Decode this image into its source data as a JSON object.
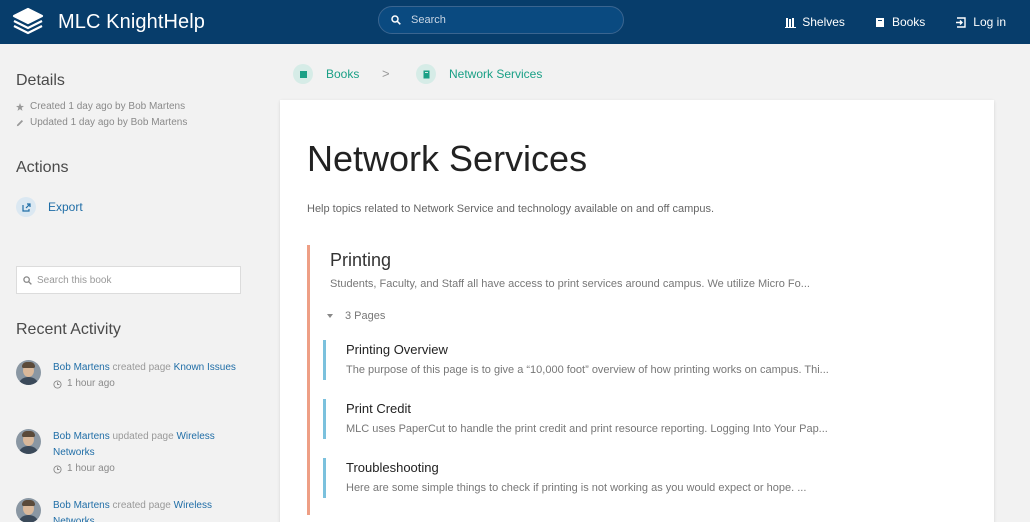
{
  "header": {
    "app_title": "MLC KnightHelp",
    "search_placeholder": "Search",
    "nav": [
      {
        "label": "Shelves",
        "icon": "shelves-icon"
      },
      {
        "label": "Books",
        "icon": "book-icon"
      },
      {
        "label": "Log in",
        "icon": "login-icon"
      }
    ],
    "bg_color": "#073d6b"
  },
  "sidebar": {
    "details_heading": "Details",
    "created": "Created 1 day ago by Bob Martens",
    "updated": "Updated 1 day ago by Bob Martens",
    "actions_heading": "Actions",
    "export_label": "Export",
    "book_search_placeholder": "Search this book",
    "recent_heading": "Recent Activity",
    "activity": [
      {
        "user": "Bob Martens",
        "verb": "created page",
        "target": "Known Issues",
        "time": "1 hour ago"
      },
      {
        "user": "Bob Martens",
        "verb": "updated page",
        "target": "Wireless Networks",
        "time": "1 hour ago"
      },
      {
        "user": "Bob Martens",
        "verb": "created page",
        "target": "Wireless Networks",
        "time": ""
      }
    ]
  },
  "breadcrumb": [
    {
      "label": "Books"
    },
    {
      "label": "Network Services"
    }
  ],
  "main": {
    "title": "Network Services",
    "description": "Help topics related to Network Service and technology available on and off campus.",
    "chapter": {
      "title": "Printing",
      "text": "Students, Faculty, and Staff all have access to print services around campus. We utilize Micro Fo...",
      "page_count": "3 Pages",
      "pages": [
        {
          "title": "Printing Overview",
          "excerpt": "The purpose of this page is to give a “10,000 foot” overview of how printing works on campus. Thi..."
        },
        {
          "title": "Print Credit",
          "excerpt": "MLC uses PaperCut to handle the print credit and print resource reporting. Logging Into Your Pap..."
        },
        {
          "title": "Troubleshooting",
          "excerpt": "Here are some simple things to check if printing is not working as you would expect or hope. ..."
        }
      ]
    },
    "accent_chapter": "#ee9f85",
    "accent_page": "#7bc1dd",
    "link_color": "#206ea7"
  }
}
